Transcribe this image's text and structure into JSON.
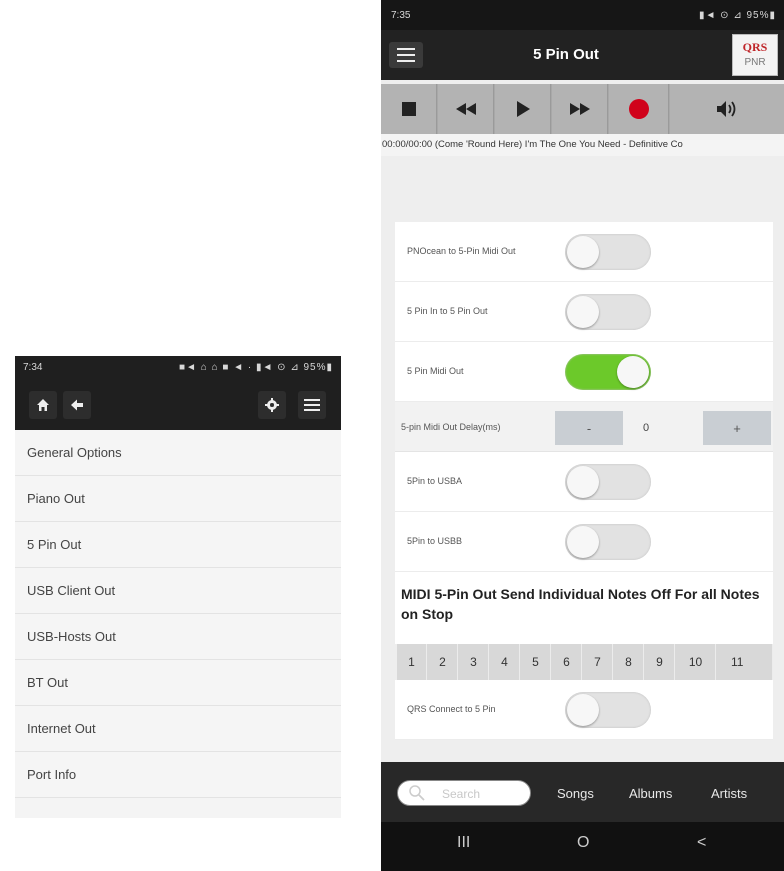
{
  "left": {
    "status": {
      "time": "7:34",
      "indicators": "■◄ ⌂ ⌂ ■ ◄ ·     ▮◄ ⊙ ⊿ 95%▮"
    },
    "menu_items": [
      {
        "label": "General Options"
      },
      {
        "label": "Piano Out"
      },
      {
        "label": "5 Pin Out"
      },
      {
        "label": "USB Client Out"
      },
      {
        "label": "USB-Hosts Out"
      },
      {
        "label": "BT Out"
      },
      {
        "label": "Internet Out"
      },
      {
        "label": "Port Info"
      }
    ]
  },
  "right": {
    "status": {
      "time": "7:35",
      "indicators": "▮◄ ⊙ ⊿ 95%▮"
    },
    "title": "5 Pin Out",
    "logo": {
      "top": "QRS",
      "bottom": "PNR"
    },
    "now_playing": "00:00/00:00 (Come 'Round Here) I'm The One You Need - Definitive Co",
    "settings": [
      {
        "label": "PNOcean to 5-Pin Midi Out",
        "on": false
      },
      {
        "label": "5 Pin In to 5 Pin Out",
        "on": false
      },
      {
        "label": "5 Pin Midi Out",
        "on": true
      }
    ],
    "stepper": {
      "label": "5-pin Midi Out Delay(ms)",
      "minus": "-",
      "value": "0",
      "plus": "+"
    },
    "settings2": [
      {
        "label": "5Pin to USBA",
        "on": false
      },
      {
        "label": "5Pin to USBB",
        "on": false
      }
    ],
    "section_title": "MIDI 5-Pin Out Send Individual Notes Off For all Notes on Stop",
    "notes": [
      "1",
      "2",
      "3",
      "4",
      "5",
      "6",
      "7",
      "8",
      "9",
      "10",
      "11"
    ],
    "qrs_connect": {
      "label": "QRS Connect to 5 Pin",
      "on": false
    },
    "search_placeholder": "Search",
    "nav_links": [
      "Songs",
      "Albums",
      "Artists"
    ],
    "sys_nav": {
      "recents": "III",
      "home": "O",
      "back": "<"
    }
  },
  "colors": {
    "toggle_on": "#6cc92a",
    "record": "#d0021b",
    "logo_red": "#c0262a"
  }
}
